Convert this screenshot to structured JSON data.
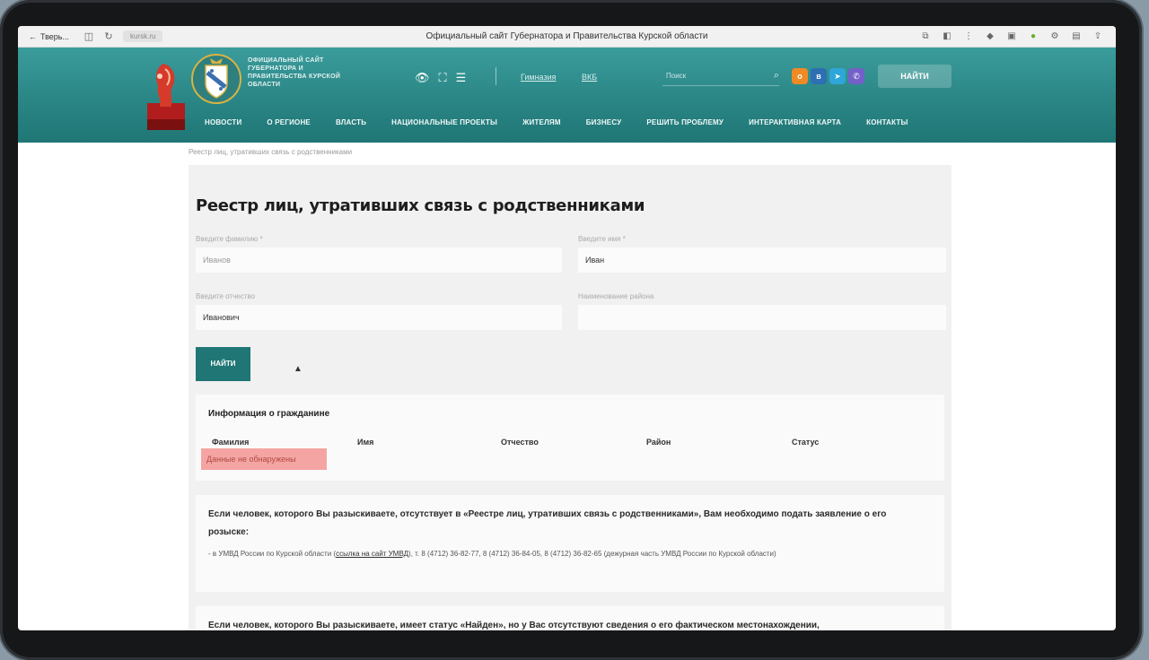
{
  "browser": {
    "tab_label": "Тверь...",
    "url": "kursk.ru",
    "page_title": "Официальный сайт Губернатора и Правительства Курской области"
  },
  "header": {
    "site_name": "ОФИЦИАЛЬНЫЙ САЙТ ГУБЕРНАТОРА И ПРАВИТЕЛЬСТВА КУРСКОЙ ОБЛАСТИ",
    "link_1": "Гимназия",
    "link_2": "ВКБ",
    "search_placeholder": "Поиск",
    "find_button": "НАЙТИ",
    "nav": [
      "НОВОСТИ",
      "О РЕГИОНЕ",
      "ВЛАСТЬ",
      "НАЦИОНАЛЬНЫЕ ПРОЕКТЫ",
      "ЖИТЕЛЯМ",
      "БИЗНЕСУ",
      "РЕШИТЬ ПРОБЛЕМУ",
      "ИНТЕРАКТИВНАЯ КАРТА",
      "КОНТАКТЫ"
    ]
  },
  "breadcrumb": "Реестр лиц, утративших связь с родственниками",
  "main": {
    "title": "Реестр лиц, утративших связь с родственниками",
    "surname_label": "Введите фамилию *",
    "surname_value": "Иванов",
    "name_label": "Введите имя *",
    "name_value": "Иван",
    "patronymic_label": "Введите отчество",
    "patronymic_value": "Иванович",
    "district_label": "Наименование района",
    "district_value": "",
    "search_button": "НАЙТИ"
  },
  "result": {
    "title": "Информация о гражданине",
    "columns": [
      "Фамилия",
      "Имя",
      "Отчество",
      "Район",
      "Статус"
    ],
    "empty_status": "Данные не обнаружены"
  },
  "info1": {
    "bold": "Если человек, которого Вы разыскиваете, отсутствует в «Реестре лиц, утративших связь с родственниками», Вам необходимо подать заявление о его розыске:",
    "detail_prefix": "- в УМВД России по Курской области (",
    "detail_link": "ссылка на сайт УМВД",
    "detail_suffix": "), т. 8 (4712) 36-82-77, 8 (4712) 36-84-05, 8 (4712) 36-82-65 (дежурная часть УМВД России по Курской области)"
  },
  "info2": {
    "bold": "Если человек, которого Вы разыскиваете, имеет статус «Найден», но у Вас отсутствуют сведения о его фактическом местонахождении,"
  },
  "colors": {
    "header_teal": "#2a8685",
    "button_teal": "#1f7675",
    "not_found_bg": "#f4a5a3"
  }
}
